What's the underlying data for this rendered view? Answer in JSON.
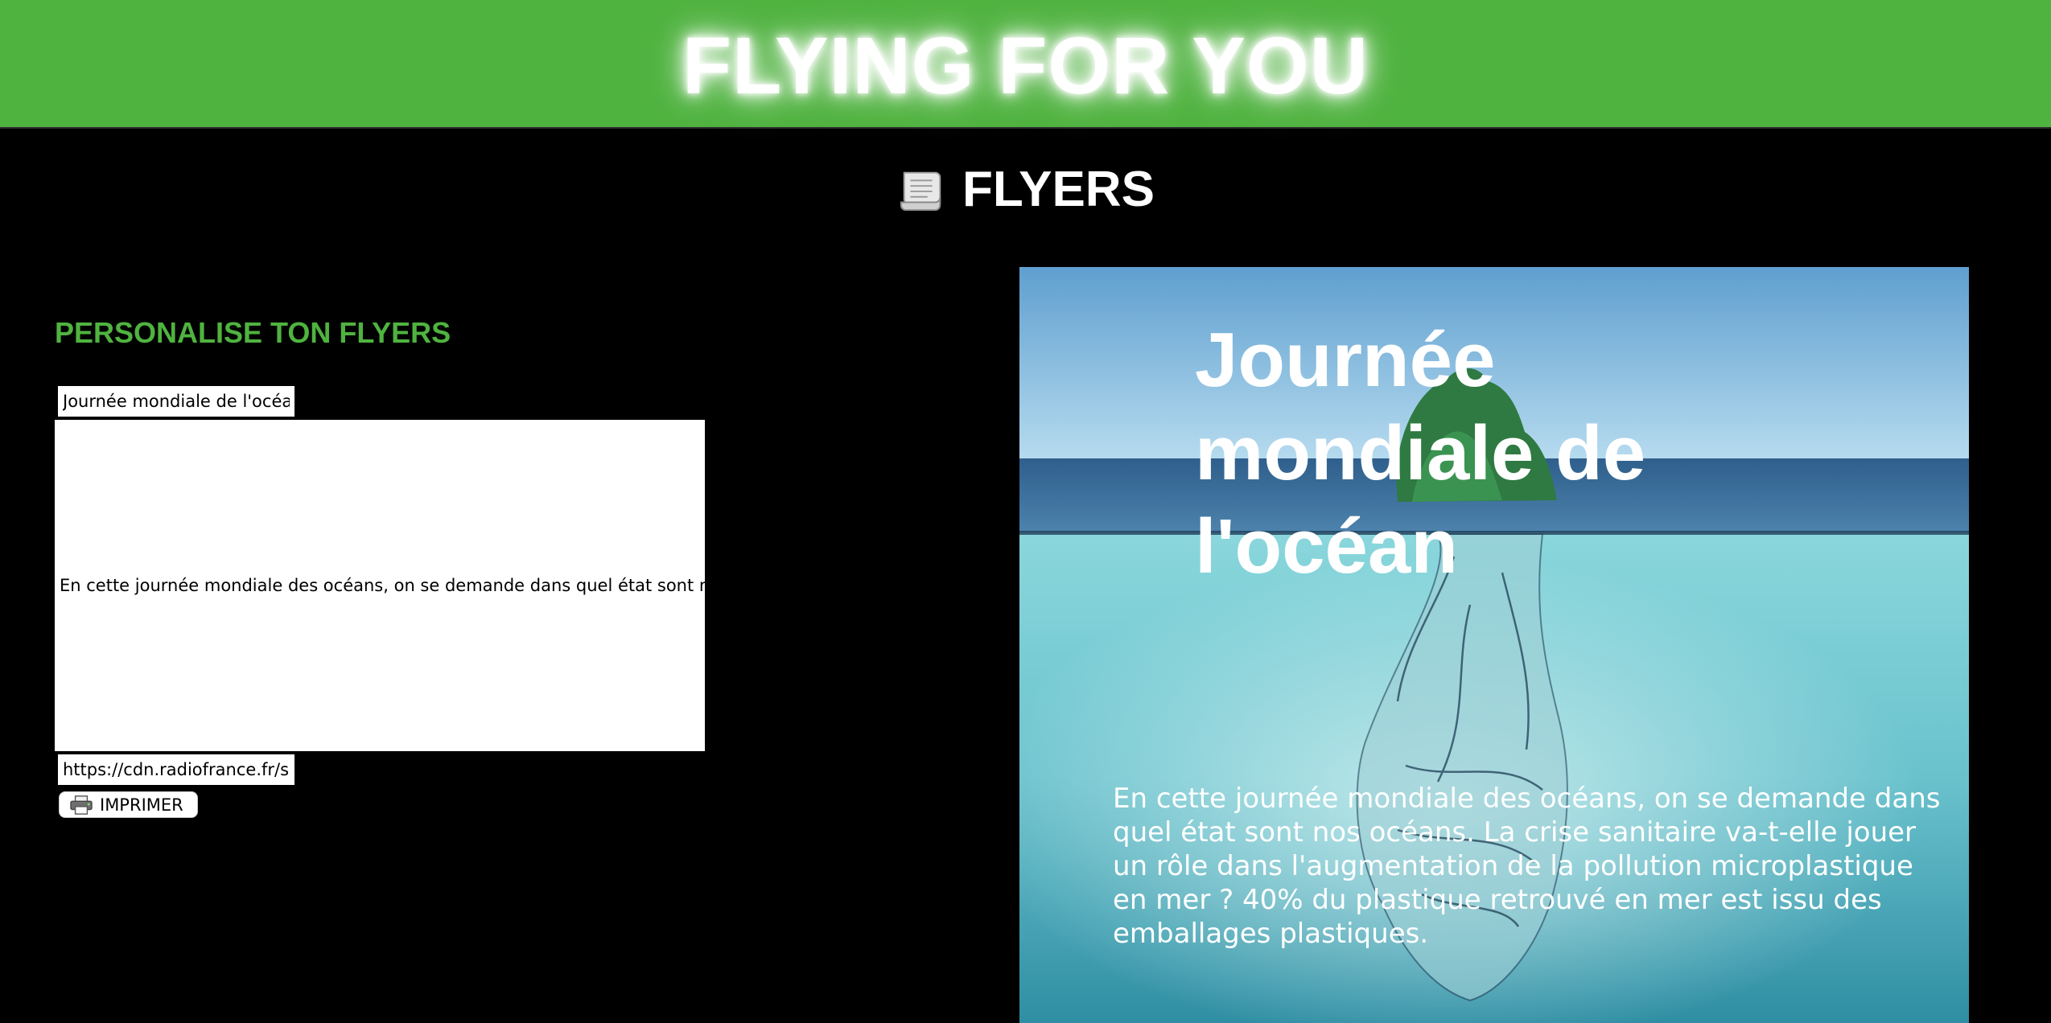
{
  "banner": {
    "title": "FLYING FOR YOU"
  },
  "section": {
    "icon": "scroll-icon",
    "title": "FLYERS"
  },
  "form": {
    "heading": "PERSONALISE TON FLYERS",
    "title_value": "Journée mondiale de l'océa",
    "body_value": "En cette journée mondiale des océans, on se demande dans quel état sont n",
    "url_value": "https://cdn.radiofrance.fr/s",
    "print_icon": "printer-icon",
    "print_label": "IMPRIMER"
  },
  "flyer": {
    "title": "Journée mondiale de l'océan",
    "body": "En cette journée mondiale des océans, on se demande dans quel état sont nos océans. La crise sanitaire va-t-elle jouer un rôle dans l'augmentation de la pollution microplastique en mer ? 40% du plastique retrouvé en mer est issu des emballages plastiques."
  },
  "colors": {
    "banner_green": "#4fb33f",
    "heading_green": "#4fb33f",
    "background": "#000000"
  }
}
